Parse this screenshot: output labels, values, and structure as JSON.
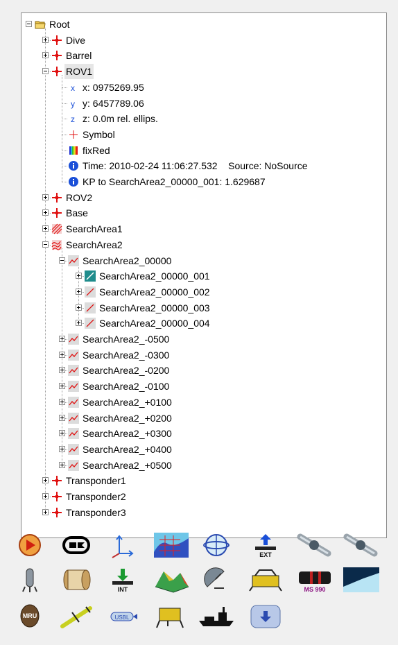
{
  "tree": {
    "nodes": [
      {
        "label": "Root",
        "icon": "folder-icon",
        "depth": 0,
        "expander": "minus"
      },
      {
        "label": "Dive",
        "icon": "red-cross-icon",
        "depth": 1,
        "expander": "plus"
      },
      {
        "label": "Barrel",
        "icon": "red-cross-icon",
        "depth": 1,
        "expander": "plus"
      },
      {
        "label": "ROV1",
        "icon": "red-cross-icon",
        "depth": 1,
        "expander": "minus",
        "selected": true
      },
      {
        "label": "x: 0975269.95",
        "icon": "axis-x-icon",
        "depth": 2
      },
      {
        "label": "y: 6457789.06",
        "icon": "axis-y-icon",
        "depth": 2
      },
      {
        "label": "z: 0.0m rel. ellips.",
        "icon": "axis-z-icon",
        "depth": 2
      },
      {
        "label": "Symbol",
        "icon": "red-plus-icon",
        "depth": 2
      },
      {
        "label": "fixRed",
        "icon": "color-palette-icon",
        "depth": 2
      },
      {
        "label": "Time: 2010-02-24 11:06:27.532    Source: NoSource",
        "icon": "info-icon",
        "depth": 2
      },
      {
        "label": "KP to SearchArea2_00000_001: 1.629687",
        "icon": "info-icon",
        "depth": 2
      },
      {
        "label": "ROV2",
        "icon": "red-cross-icon",
        "depth": 1,
        "expander": "plus"
      },
      {
        "label": "Base",
        "icon": "red-cross-icon",
        "depth": 1,
        "expander": "plus"
      },
      {
        "label": "SearchArea1",
        "icon": "hatched-area-icon",
        "depth": 1,
        "expander": "plus"
      },
      {
        "label": "SearchArea2",
        "icon": "wave-hatched-area-icon",
        "depth": 1,
        "expander": "minus"
      },
      {
        "label": "SearchArea2_00000",
        "icon": "polyline-icon",
        "depth": 2,
        "expander": "minus"
      },
      {
        "label": "SearchArea2_00000_001",
        "icon": "line-active-icon",
        "depth": 3,
        "expander": "plus"
      },
      {
        "label": "SearchArea2_00000_002",
        "icon": "line-icon",
        "depth": 3,
        "expander": "plus"
      },
      {
        "label": "SearchArea2_00000_003",
        "icon": "line-icon",
        "depth": 3,
        "expander": "plus"
      },
      {
        "label": "SearchArea2_00000_004",
        "icon": "line-icon",
        "depth": 3,
        "expander": "plus"
      },
      {
        "label": "SearchArea2_-0500",
        "icon": "polyline-icon",
        "depth": 2,
        "expander": "plus"
      },
      {
        "label": "SearchArea2_-0300",
        "icon": "polyline-icon",
        "depth": 2,
        "expander": "plus"
      },
      {
        "label": "SearchArea2_-0200",
        "icon": "polyline-icon",
        "depth": 2,
        "expander": "plus"
      },
      {
        "label": "SearchArea2_-0100",
        "icon": "polyline-icon",
        "depth": 2,
        "expander": "plus"
      },
      {
        "label": "SearchArea2_+0100",
        "icon": "polyline-icon",
        "depth": 2,
        "expander": "plus"
      },
      {
        "label": "SearchArea2_+0200",
        "icon": "polyline-icon",
        "depth": 2,
        "expander": "plus"
      },
      {
        "label": "SearchArea2_+0300",
        "icon": "polyline-icon",
        "depth": 2,
        "expander": "plus"
      },
      {
        "label": "SearchArea2_+0400",
        "icon": "polyline-icon",
        "depth": 2,
        "expander": "plus"
      },
      {
        "label": "SearchArea2_+0500",
        "icon": "polyline-icon",
        "depth": 2,
        "expander": "plus"
      },
      {
        "label": "Transponder1",
        "icon": "red-cross-icon",
        "depth": 1,
        "expander": "plus"
      },
      {
        "label": "Transponder2",
        "icon": "red-cross-icon",
        "depth": 1,
        "expander": "plus"
      },
      {
        "label": "Transponder3",
        "icon": "red-cross-icon",
        "depth": 1,
        "expander": "plus"
      }
    ]
  },
  "toolbar": {
    "buttons": [
      {
        "icon": "play-circle-icon",
        "text": ""
      },
      {
        "icon": "plug-connector-icon",
        "text": ""
      },
      {
        "icon": "axes-3d-icon",
        "text": ""
      },
      {
        "icon": "bathymetry-map-icon",
        "text": ""
      },
      {
        "icon": "globe-orbit-icon",
        "text": ""
      },
      {
        "icon": "external-import-icon",
        "text": "EXT"
      },
      {
        "icon": "pipe-grey-icon",
        "text": ""
      },
      {
        "icon": "pipe-grey-2-icon",
        "text": ""
      },
      {
        "icon": "sensor-probe-icon",
        "text": ""
      },
      {
        "icon": "winch-drum-icon",
        "text": ""
      },
      {
        "icon": "internal-import-icon",
        "text": "INT"
      },
      {
        "icon": "terrain-3d-icon",
        "text": ""
      },
      {
        "icon": "satellite-dish-icon",
        "text": ""
      },
      {
        "icon": "rov-vehicle-icon",
        "text": ""
      },
      {
        "icon": "sonar-ms990-icon",
        "text": "MS 990"
      },
      {
        "icon": "seafloor-view-icon",
        "text": ""
      },
      {
        "icon": "mru-sensor-icon",
        "text": "MRU"
      },
      {
        "icon": "auv-glider-icon",
        "text": ""
      },
      {
        "icon": "usbl-torpedo-icon",
        "text": "USBL"
      },
      {
        "icon": "rov-frame-icon",
        "text": ""
      },
      {
        "icon": "survey-ship-icon",
        "text": ""
      },
      {
        "icon": "download-button-icon",
        "text": ""
      }
    ]
  },
  "colors": {
    "red": "#e01010",
    "selection": "#e6e6e6",
    "info_blue": "#1a4fd8",
    "teal": "#1f8c8c"
  }
}
